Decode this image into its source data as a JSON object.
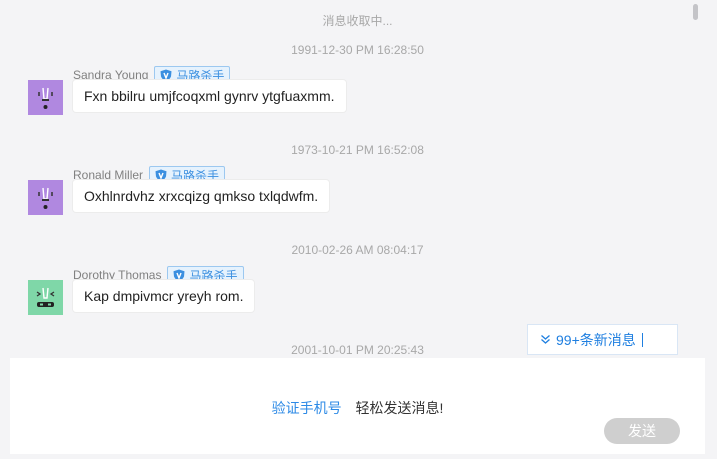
{
  "loading_text": "消息收取中...",
  "messages": [
    {
      "timestamp": "1991-12-30 PM 16:28:50",
      "sender": "Sandra Young",
      "badge": "马路杀手",
      "text": "Fxn bbilru umjfcoqxml gynrv ytgfuaxmm.",
      "avatar_color": "#b088e0"
    },
    {
      "timestamp": "1973-10-21 PM 16:52:08",
      "sender": "Ronald Miller",
      "badge": "马路杀手",
      "text": "Oxhlnrdvhz xrxcqizg qmkso txlqdwfm.",
      "avatar_color": "#b088e0"
    },
    {
      "timestamp": "2010-02-26 AM 08:04:17",
      "sender": "Dorothy Thomas",
      "badge": "马路杀手",
      "text": "Kap dmpivmcr yreyh rom.",
      "avatar_color": "#7fd7a8"
    }
  ],
  "last_timestamp": "2001-10-01 PM 20:25:43",
  "new_messages_label": "99+条新消息",
  "verify_link": "验证手机号",
  "verify_text": "轻松发送消息!",
  "send_label": "发送",
  "icons": {
    "badge": "shield-icon",
    "new_messages": "double-chevron-down-icon"
  }
}
